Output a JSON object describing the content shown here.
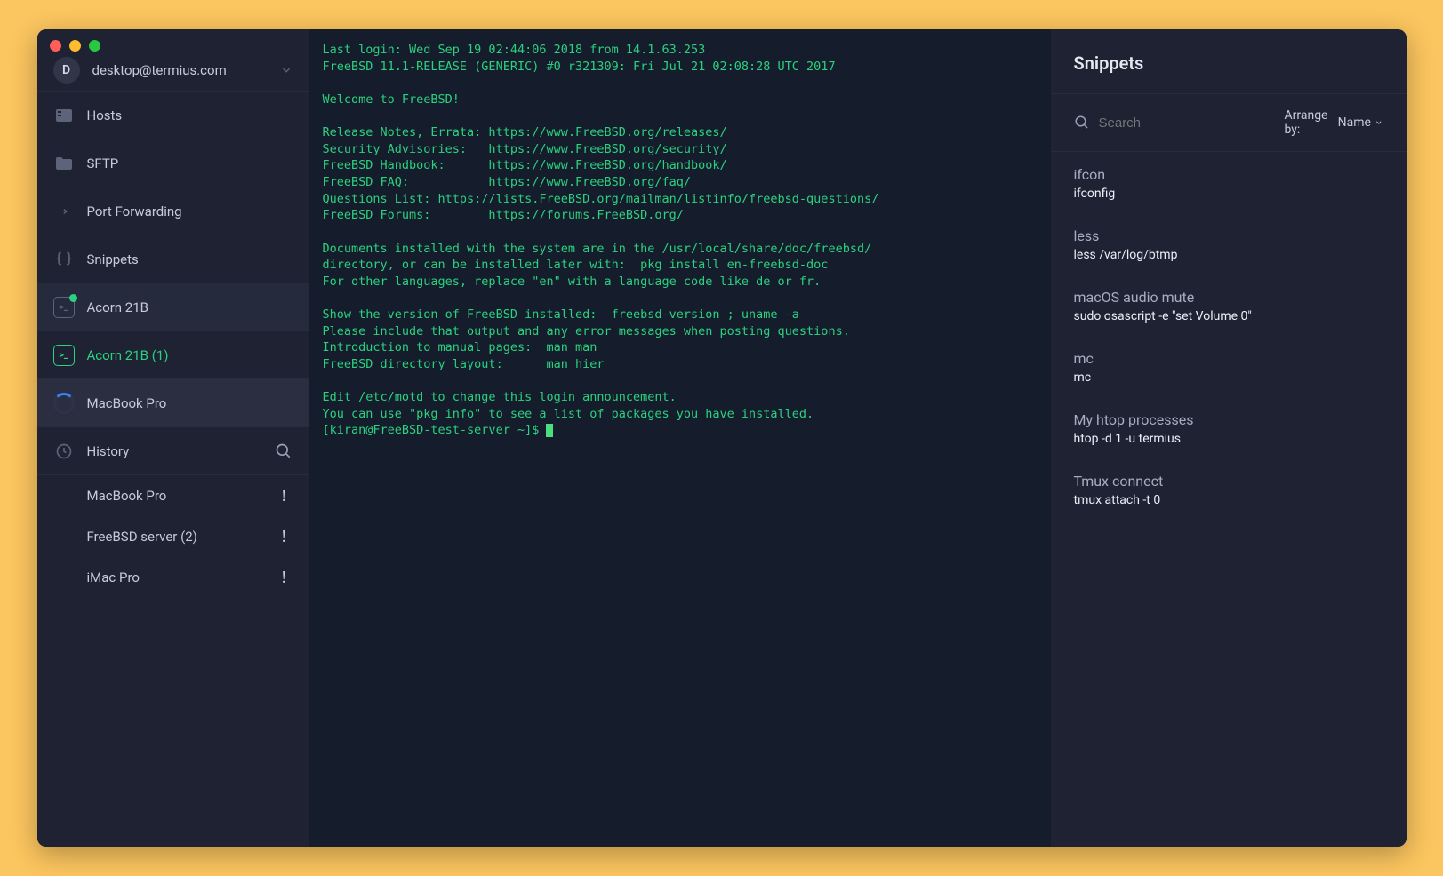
{
  "account": {
    "avatar_initial": "D",
    "email": "desktop@termius.com"
  },
  "sidebar": {
    "nav": [
      {
        "label": "Hosts"
      },
      {
        "label": "SFTP"
      },
      {
        "label": "Port Forwarding"
      },
      {
        "label": "Snippets"
      }
    ],
    "sessions": [
      {
        "label": "Acorn 21B"
      },
      {
        "label": "Acorn 21B (1)"
      },
      {
        "label": "MacBook Pro"
      }
    ],
    "history_label": "History",
    "history": [
      {
        "label": "MacBook Pro"
      },
      {
        "label": "FreeBSD server (2)"
      },
      {
        "label": "iMac Pro"
      }
    ]
  },
  "terminal": {
    "lines": "Last login: Wed Sep 19 02:44:06 2018 from 14.1.63.253\nFreeBSD 11.1-RELEASE (GENERIC) #0 r321309: Fri Jul 21 02:08:28 UTC 2017\n\nWelcome to FreeBSD!\n\nRelease Notes, Errata: https://www.FreeBSD.org/releases/\nSecurity Advisories:   https://www.FreeBSD.org/security/\nFreeBSD Handbook:      https://www.FreeBSD.org/handbook/\nFreeBSD FAQ:           https://www.FreeBSD.org/faq/\nQuestions List: https://lists.FreeBSD.org/mailman/listinfo/freebsd-questions/\nFreeBSD Forums:        https://forums.FreeBSD.org/\n\nDocuments installed with the system are in the /usr/local/share/doc/freebsd/\ndirectory, or can be installed later with:  pkg install en-freebsd-doc\nFor other languages, replace \"en\" with a language code like de or fr.\n\nShow the version of FreeBSD installed:  freebsd-version ; uname -a\nPlease include that output and any error messages when posting questions.\nIntroduction to manual pages:  man man\nFreeBSD directory layout:      man hier\n\nEdit /etc/motd to change this login announcement.\nYou can use \"pkg info\" to see a list of packages you have installed.",
    "prompt": "[kiran@FreeBSD-test-server ~]$ "
  },
  "panel": {
    "title": "Snippets",
    "search_placeholder": "Search",
    "arrange_label": "Arrange by:",
    "arrange_value": "Name",
    "snippets": [
      {
        "name": "ifcon",
        "cmd": "ifconfig"
      },
      {
        "name": "less",
        "cmd": "less /var/log/btmp"
      },
      {
        "name": "macOS audio mute",
        "cmd": "sudo osascript -e \"set Volume 0\""
      },
      {
        "name": "mc",
        "cmd": "mc"
      },
      {
        "name": "My htop processes",
        "cmd": "htop -d 1 -u termius"
      },
      {
        "name": "Tmux connect",
        "cmd": "tmux attach -t 0"
      }
    ]
  }
}
